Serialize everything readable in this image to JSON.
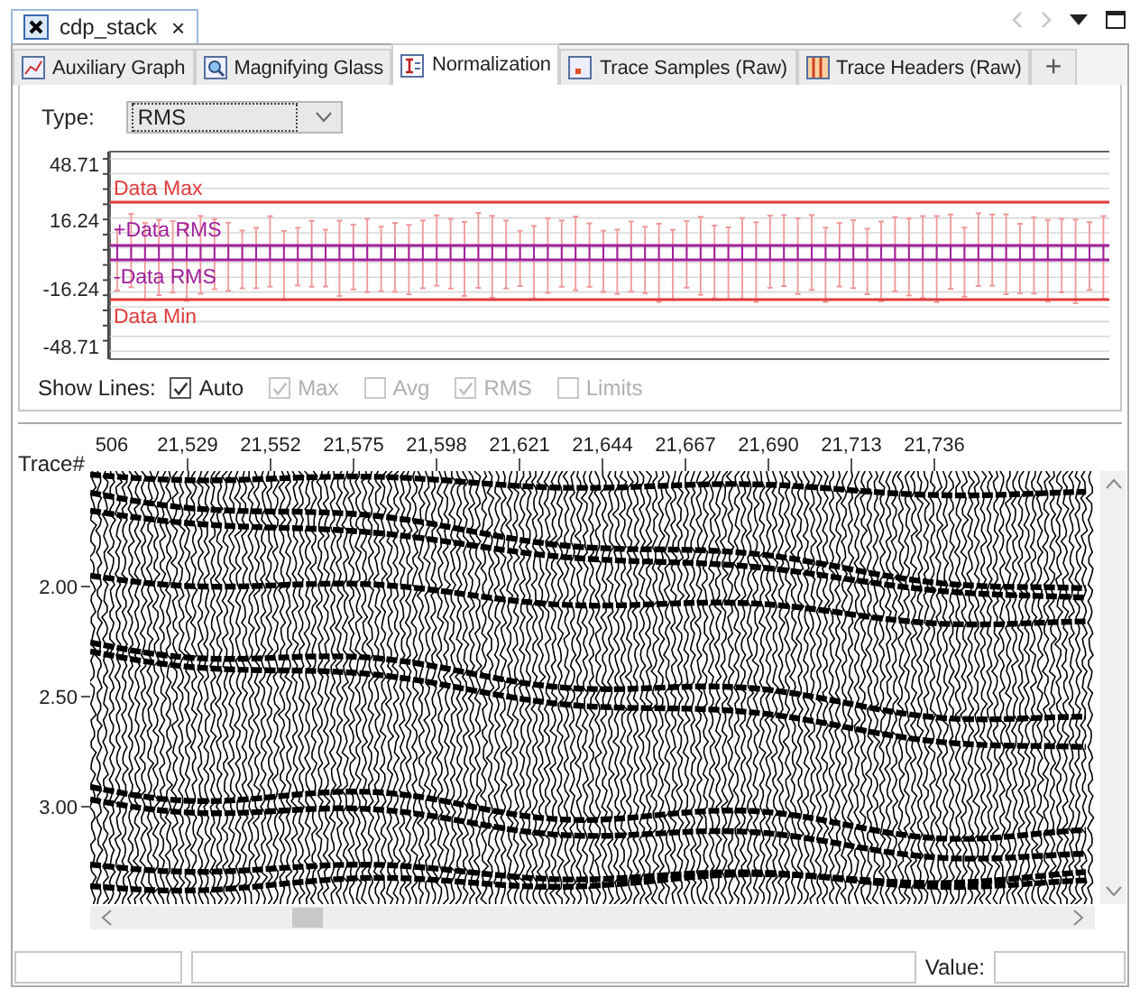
{
  "editor_tab": {
    "title": "cdp_stack",
    "close": "×"
  },
  "view_tabs": [
    {
      "label": "Auxiliary Graph",
      "kind": "graph",
      "selected": false
    },
    {
      "label": "Magnifying Glass",
      "kind": "magnifier",
      "selected": false
    },
    {
      "label": "Normalization",
      "kind": "normalization",
      "selected": true
    },
    {
      "label": "Trace Samples (Raw)",
      "kind": "samples",
      "selected": false
    },
    {
      "label": "Trace Headers (Raw)",
      "kind": "headers",
      "selected": false
    }
  ],
  "add_tab": "+",
  "type_field": {
    "label": "Type:",
    "value": "RMS"
  },
  "normalization_chart": {
    "y_ticks": [
      "48.71",
      "16.24",
      "-16.24",
      "-48.71"
    ],
    "lines": [
      {
        "label": "Data Max",
        "color": "#e03c3c"
      },
      {
        "label": "+Data RMS",
        "color": "#a0209c"
      },
      {
        "label": "-Data RMS",
        "color": "#a0209c"
      },
      {
        "label": "Data Min",
        "color": "#e03c3c"
      }
    ]
  },
  "show_lines": {
    "label": "Show Lines:",
    "options": [
      {
        "label": "Auto",
        "checked": true,
        "disabled": false
      },
      {
        "label": "Max",
        "checked": true,
        "disabled": true
      },
      {
        "label": "Avg",
        "checked": false,
        "disabled": true
      },
      {
        "label": "RMS",
        "checked": true,
        "disabled": true
      },
      {
        "label": "Limits",
        "checked": false,
        "disabled": true
      }
    ]
  },
  "seismic": {
    "y_axis_title": "Trace#",
    "x_ticks": [
      "506",
      "21,529",
      "21,552",
      "21,575",
      "21,598",
      "21,621",
      "21,644",
      "21,667",
      "21,690",
      "21,713",
      "21,736"
    ],
    "y_ticks": [
      "2.00",
      "2.50",
      "3.00"
    ]
  },
  "status_bar": {
    "value_label": "Value:"
  }
}
